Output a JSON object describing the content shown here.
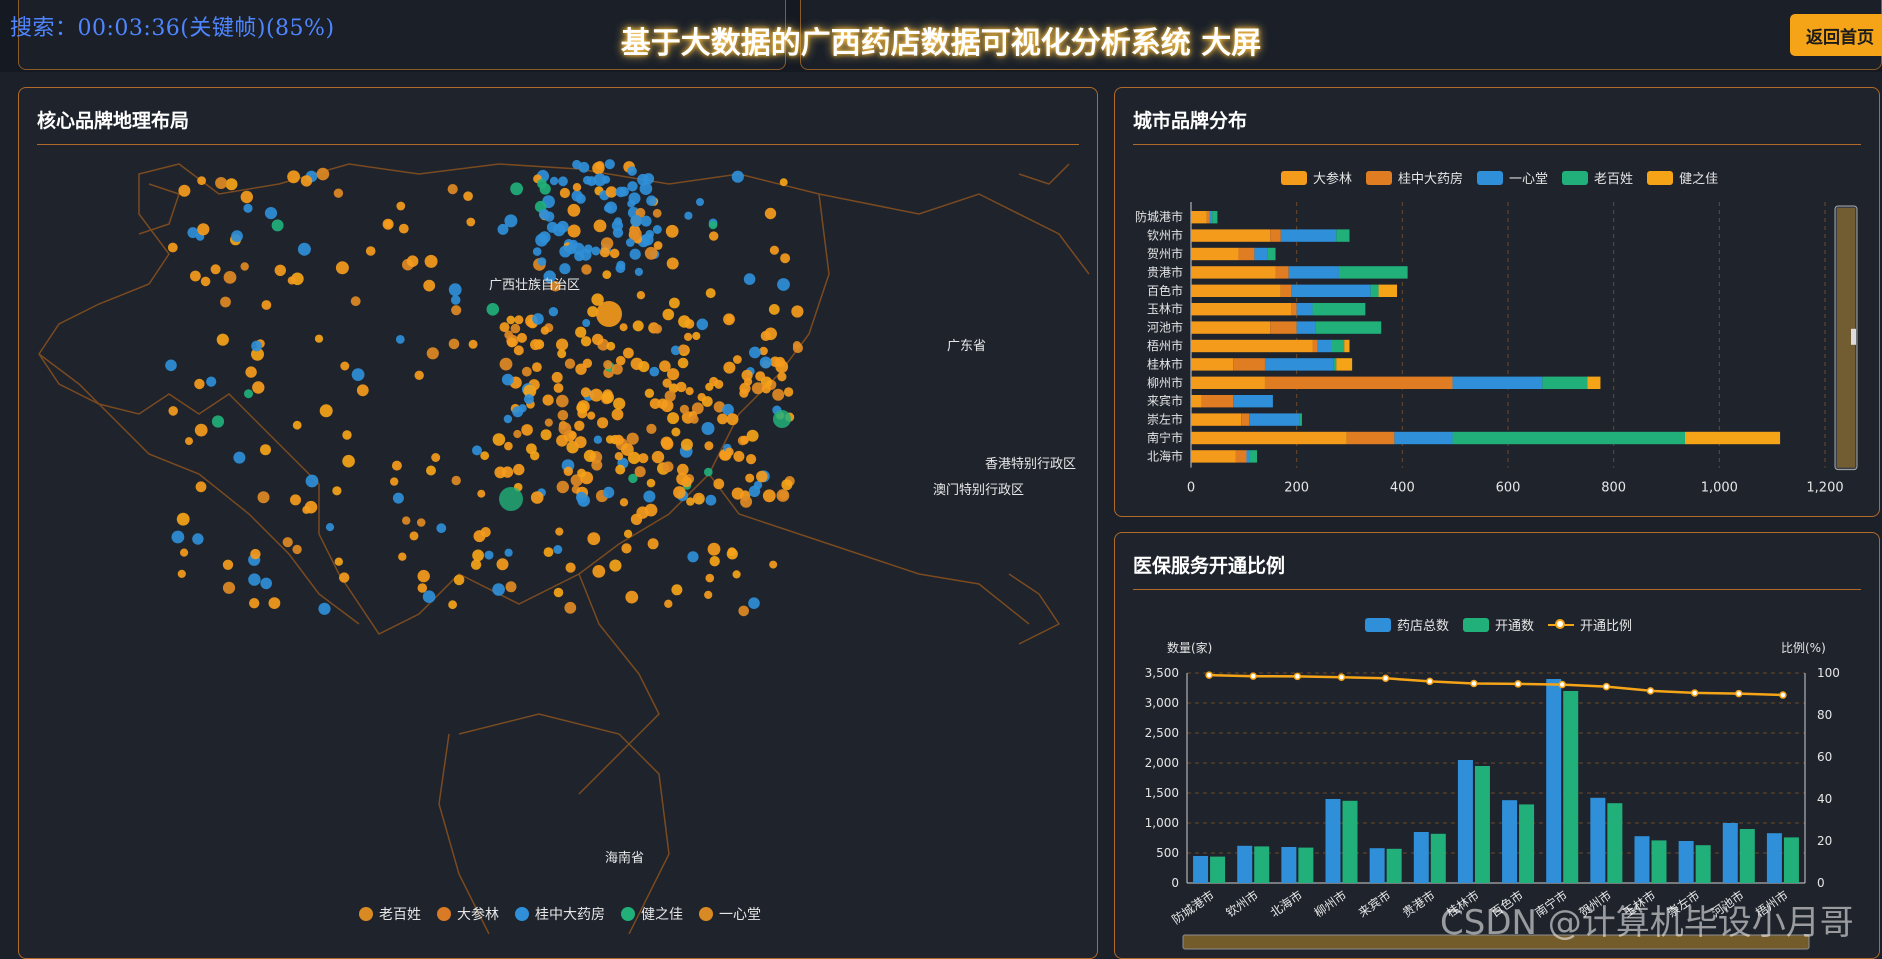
{
  "overlay": {
    "search_text": "搜索：00:03:36(关键帧)(85%)"
  },
  "header": {
    "title": "基于大数据的广西药店数据可视化分析系统 大屏",
    "back_label": "返回首页"
  },
  "colors": {
    "dasenlin": "#f59b1c",
    "guizhong": "#e07d22",
    "yixintang": "#2f8fd8",
    "laobaixing": "#22b07a",
    "jianzhijia": "#f5a418",
    "border": "#b06a2a",
    "bg": "#1e232c"
  },
  "map_panel": {
    "title": "核心品牌地理布局",
    "labels": {
      "guangxi": "广西壮族自治区",
      "guangdong": "广东省",
      "hongkong": "香港特别行政区",
      "macau": "澳门特别行政区",
      "hainan": "海南省"
    },
    "legend": [
      {
        "name": "老百姓",
        "color": "#d98a22"
      },
      {
        "name": "大参林",
        "color": "#d97a24"
      },
      {
        "name": "桂中大药房",
        "color": "#2f8fd8"
      },
      {
        "name": "健之佳",
        "color": "#22b07a"
      },
      {
        "name": "一心堂",
        "color": "#d98a22"
      }
    ]
  },
  "brand_panel": {
    "title": "城市品牌分布",
    "chart_data": {
      "type": "bar",
      "orientation": "horizontal",
      "stacked": true,
      "categories": [
        "防城港市",
        "钦州市",
        "贺州市",
        "贵港市",
        "百色市",
        "玉林市",
        "河池市",
        "梧州市",
        "桂林市",
        "柳州市",
        "来宾市",
        "崇左市",
        "南宁市",
        "北海市"
      ],
      "series": [
        {
          "name": "大参林",
          "color": "#f59b1c",
          "values": [
            30,
            150,
            90,
            160,
            170,
            190,
            150,
            230,
            80,
            140,
            20,
            95,
            295,
            85
          ]
        },
        {
          "name": "桂中大药房",
          "color": "#e07d22",
          "values": [
            5,
            20,
            30,
            25,
            20,
            10,
            50,
            10,
            60,
            355,
            60,
            15,
            90,
            20
          ]
        },
        {
          "name": "一心堂",
          "color": "#2f8fd8",
          "values": [
            5,
            105,
            25,
            95,
            150,
            30,
            35,
            25,
            130,
            170,
            75,
            95,
            110,
            5
          ]
        },
        {
          "name": "老百姓",
          "color": "#22b07a",
          "values": [
            10,
            25,
            15,
            130,
            15,
            100,
            125,
            25,
            5,
            85,
            0,
            5,
            440,
            15
          ]
        },
        {
          "name": "健之佳",
          "color": "#f5a418",
          "values": [
            0,
            0,
            0,
            0,
            35,
            0,
            0,
            10,
            30,
            25,
            0,
            0,
            180,
            0
          ]
        }
      ],
      "xlim": [
        0,
        1200
      ],
      "xticks": [
        "0",
        "200",
        "400",
        "600",
        "800",
        "1,000",
        "1,200"
      ],
      "legend_position": "top-center"
    }
  },
  "insurance_panel": {
    "title": "医保服务开通比例",
    "y_left_label": "数量(家)",
    "y_right_label": "比例(%)",
    "chart_data": {
      "type": "bar",
      "categories": [
        "防城港市",
        "钦州市",
        "北海市",
        "柳州市",
        "来宾市",
        "贵港市",
        "桂林市",
        "百色市",
        "南宁市",
        "贺州市",
        "玉林市",
        "崇左市",
        "河池市",
        "梧州市"
      ],
      "series": [
        {
          "name": "药店总数",
          "color": "#2f8fd8",
          "values": [
            450,
            620,
            600,
            1400,
            580,
            850,
            2050,
            1380,
            3400,
            1420,
            780,
            700,
            1000,
            830
          ]
        },
        {
          "name": "开通数",
          "color": "#22b07a",
          "values": [
            440,
            610,
            590,
            1370,
            570,
            820,
            1950,
            1310,
            3200,
            1330,
            710,
            630,
            900,
            760
          ]
        },
        {
          "name": "开通比例",
          "type": "line",
          "color": "#f5a418",
          "axis": "right",
          "values": [
            99,
            98.5,
            98.4,
            98,
            97.5,
            96,
            95,
            94.8,
            94.5,
            93.5,
            91.5,
            90.5,
            90.2,
            89.5
          ]
        }
      ],
      "ylim_left": [
        0,
        3500
      ],
      "yticks_left": [
        "0",
        "500",
        "1,000",
        "1,500",
        "2,000",
        "2,500",
        "3,000",
        "3,500"
      ],
      "ylim_right": [
        0,
        100
      ],
      "yticks_right": [
        "0",
        "20",
        "40",
        "60",
        "80",
        "100"
      ],
      "legend_position": "top-center"
    }
  },
  "watermark": {
    "text": "CSDN @计算机毕设小月哥"
  }
}
